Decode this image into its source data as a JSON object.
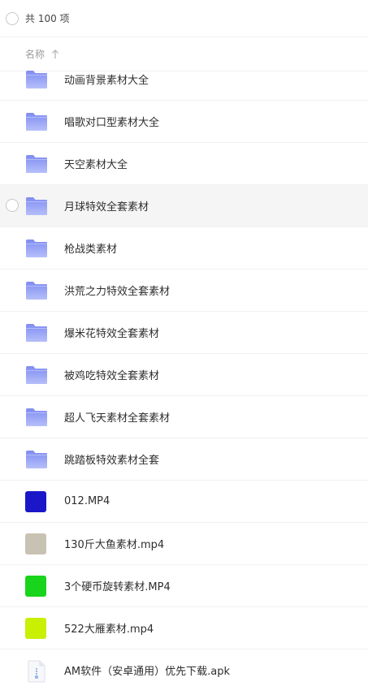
{
  "header": {
    "count_text": "共 100 项"
  },
  "sort": {
    "label": "名称"
  },
  "files": [
    {
      "name": "动画背景素材大全",
      "type": "folder"
    },
    {
      "name": "唱歌对口型素材大全",
      "type": "folder"
    },
    {
      "name": "天空素材大全",
      "type": "folder"
    },
    {
      "name": "月球特效全套素材",
      "type": "folder",
      "selected": true
    },
    {
      "name": "枪战类素材",
      "type": "folder"
    },
    {
      "name": "洪荒之力特效全套素材",
      "type": "folder"
    },
    {
      "name": "爆米花特效全套素材",
      "type": "folder"
    },
    {
      "name": "被鸡吃特效全套素材",
      "type": "folder"
    },
    {
      "name": "超人飞天素材全套素材",
      "type": "folder"
    },
    {
      "name": "跳踏板特效素材全套",
      "type": "folder"
    },
    {
      "name": "012.MP4",
      "type": "video",
      "thumb_color": "#1a17c8"
    },
    {
      "name": "130斤大鱼素材.mp4",
      "type": "video",
      "thumb_color": "#c8c2b2"
    },
    {
      "name": "3个硬币旋转素材.MP4",
      "type": "video",
      "thumb_color": "#18d41a"
    },
    {
      "name": "522大雁素材.mp4",
      "type": "video",
      "thumb_color": "#c8f000"
    },
    {
      "name": "AM软件（安卓通用）优先下载.apk",
      "type": "apk"
    }
  ],
  "colors": {
    "folder_top": "#7f8cf2",
    "folder_bottom": "#b6bff9",
    "selected_bg": "#f5f5f5"
  }
}
